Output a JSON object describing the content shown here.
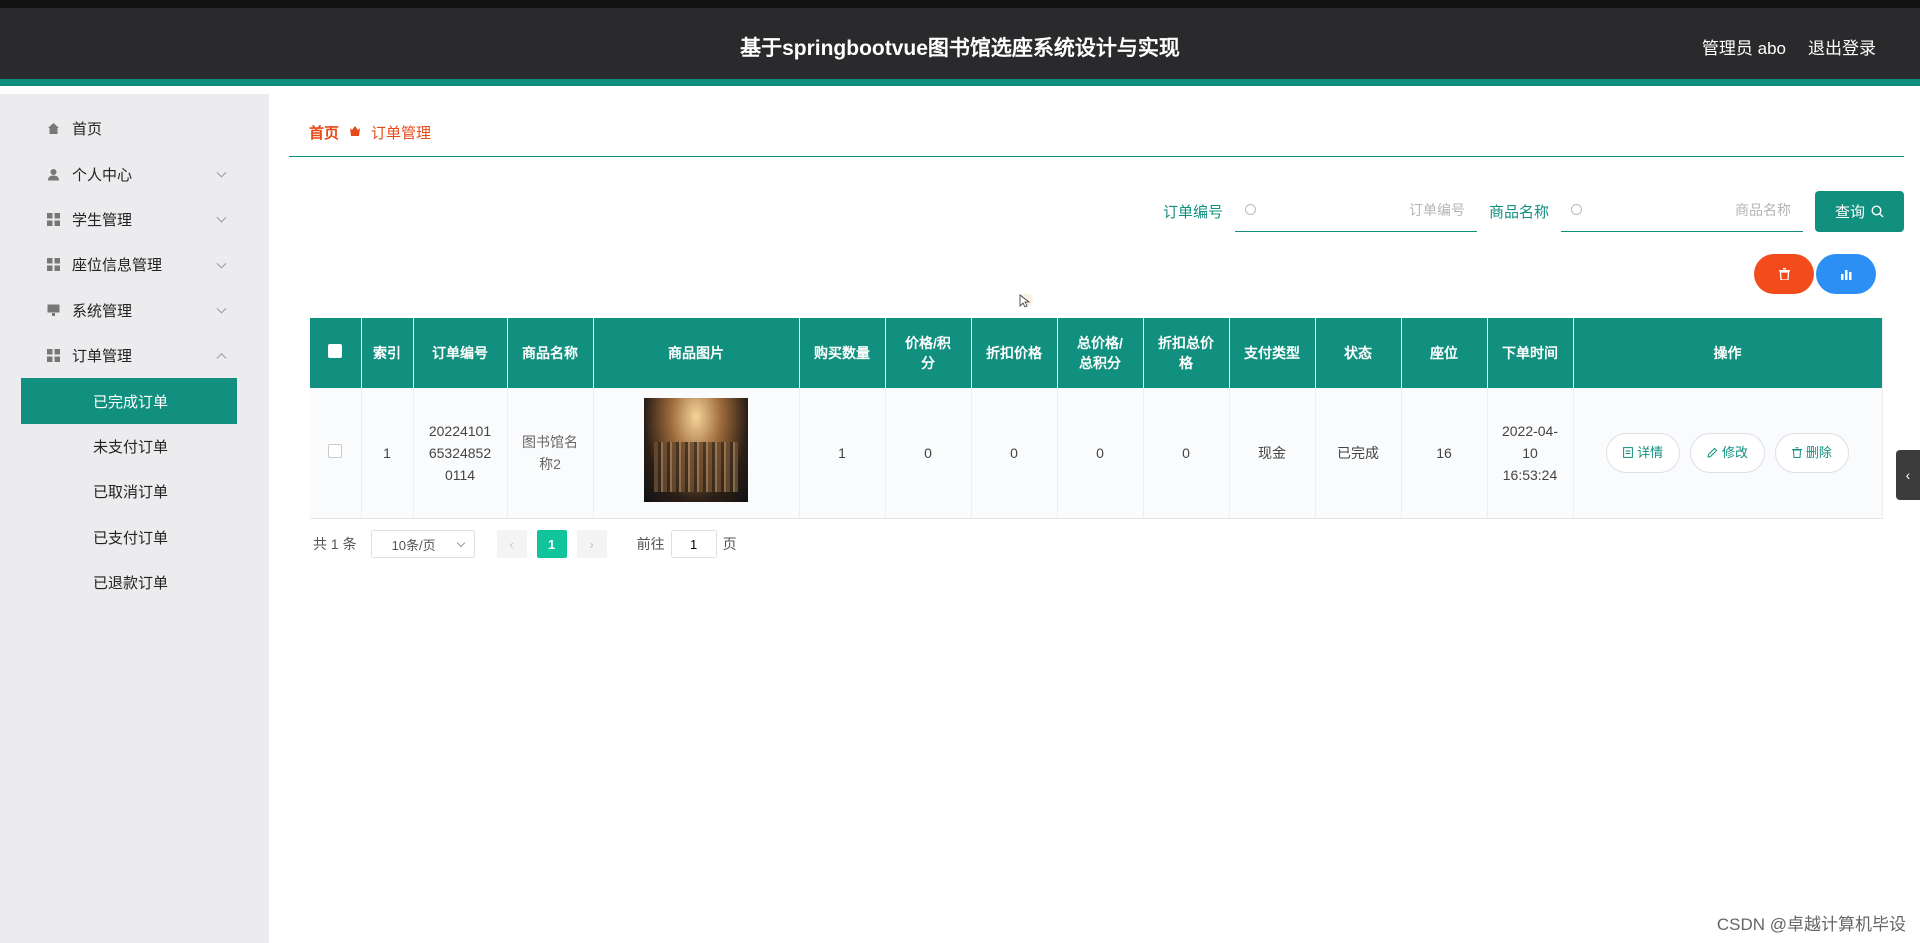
{
  "header": {
    "title": "基于springbootvue图书馆选座系统设计与实现",
    "user_label": "管理员 abo",
    "logout_label": "退出登录"
  },
  "sidebar": {
    "items": [
      {
        "label": "首页",
        "icon": "home-icon"
      },
      {
        "label": "个人中心",
        "icon": "user-icon"
      },
      {
        "label": "学生管理",
        "icon": "grid-icon"
      },
      {
        "label": "座位信息管理",
        "icon": "grid-icon"
      },
      {
        "label": "系统管理",
        "icon": "monitor-icon"
      },
      {
        "label": "订单管理",
        "icon": "grid-icon"
      }
    ],
    "subitems": [
      {
        "label": "已完成订单",
        "active": true
      },
      {
        "label": "未支付订单"
      },
      {
        "label": "已取消订单"
      },
      {
        "label": "已支付订单"
      },
      {
        "label": "已退款订单"
      }
    ]
  },
  "breadcrumb": {
    "home": "首页",
    "current": "订单管理"
  },
  "search": {
    "order_label": "订单编号",
    "order_placeholder": "订单编号",
    "order_value": "",
    "goods_label": "商品名称",
    "goods_placeholder": "商品名称",
    "goods_value": "",
    "query_label": "查询"
  },
  "table": {
    "headers": [
      "索引",
      "订单编号",
      "商品名称",
      "商品图片",
      "购买数量",
      "价格/积分",
      "折扣价格",
      "总价格/总积分",
      "折扣总价格",
      "支付类型",
      "状态",
      "座位",
      "下单时间",
      "操作"
    ],
    "rows": [
      {
        "index": "1",
        "order_no": "20224101653248520114",
        "goods_name": "图书馆名称2",
        "qty": "1",
        "price": "0",
        "discount_price": "0",
        "total_price": "0",
        "discount_total": "0",
        "pay_type": "现金",
        "status": "已完成",
        "seat": "16",
        "order_time": "2022-04-10 16:53:24"
      }
    ],
    "actions": {
      "detail": "详情",
      "edit": "修改",
      "delete": "删除"
    }
  },
  "pager": {
    "total_text": "共 1 条",
    "page_size": "10条/页",
    "current_page": "1",
    "goto_label": "前往",
    "goto_value": "1",
    "page_suffix": "页"
  },
  "watermark": "CSDN @卓越计算机毕设",
  "colors": {
    "primary": "#12907f",
    "danger": "#f24c1c",
    "info": "#2c8ff4",
    "header_bg": "#2a2a2c"
  }
}
